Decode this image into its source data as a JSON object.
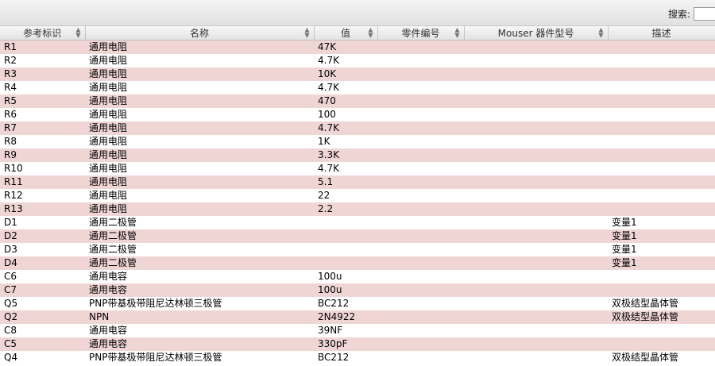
{
  "search": {
    "label": "搜索:",
    "value": ""
  },
  "table": {
    "columns": [
      {
        "key": "ref",
        "label": "参考标识"
      },
      {
        "key": "name",
        "label": "名称"
      },
      {
        "key": "value",
        "label": "值"
      },
      {
        "key": "part",
        "label": "零件编号"
      },
      {
        "key": "mouser",
        "label": "Mouser 器件型号"
      },
      {
        "key": "desc",
        "label": "描述"
      }
    ],
    "rows": [
      [
        "R1",
        "通用电阻",
        "47K",
        "",
        "",
        ""
      ],
      [
        "R2",
        "通用电阻",
        "4.7K",
        "",
        "",
        ""
      ],
      [
        "R3",
        "通用电阻",
        "10K",
        "",
        "",
        ""
      ],
      [
        "R4",
        "通用电阻",
        "4.7K",
        "",
        "",
        ""
      ],
      [
        "R5",
        "通用电阻",
        "470",
        "",
        "",
        ""
      ],
      [
        "R6",
        "通用电阻",
        "100",
        "",
        "",
        ""
      ],
      [
        "R7",
        "通用电阻",
        "4.7K",
        "",
        "",
        ""
      ],
      [
        "R8",
        "通用电阻",
        "1K",
        "",
        "",
        ""
      ],
      [
        "R9",
        "通用电阻",
        "3.3K",
        "",
        "",
        ""
      ],
      [
        "R10",
        "通用电阻",
        "4.7K",
        "",
        "",
        ""
      ],
      [
        "R11",
        "通用电阻",
        "5.1",
        "",
        "",
        ""
      ],
      [
        "R12",
        "通用电阻",
        "22",
        "",
        "",
        ""
      ],
      [
        "R13",
        "通用电阻",
        "2.2",
        "",
        "",
        ""
      ],
      [
        "D1",
        "通用二极管",
        "",
        "",
        "",
        "变量1"
      ],
      [
        "D2",
        "通用二极管",
        "",
        "",
        "",
        "变量1"
      ],
      [
        "D3",
        "通用二极管",
        "",
        "",
        "",
        "变量1"
      ],
      [
        "D4",
        "通用二极管",
        "",
        "",
        "",
        "变量1"
      ],
      [
        "C6",
        "通用电容",
        "100u",
        "",
        "",
        ""
      ],
      [
        "C7",
        "通用电容",
        "100u",
        "",
        "",
        ""
      ],
      [
        "Q5",
        "PNP带基极带阻尼达林顿三极管",
        "BC212",
        "",
        "",
        "双极结型晶体管"
      ],
      [
        "Q2",
        "NPN",
        "2N4922",
        "",
        "",
        "双极结型晶体管"
      ],
      [
        "C8",
        "通用电容",
        "39NF",
        "",
        "",
        ""
      ],
      [
        "C5",
        "通用电容",
        "330pF",
        "",
        "",
        ""
      ],
      [
        "Q4",
        "PNP带基极带阻尼达林顿三极管",
        "BC212",
        "",
        "",
        "双极结型晶体管"
      ]
    ]
  }
}
